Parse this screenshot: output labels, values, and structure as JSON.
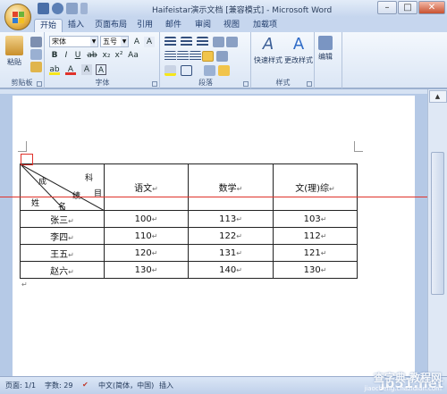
{
  "window": {
    "title": "Haifeistar演示文档 [兼容模式] - Microsoft Word"
  },
  "tabs": [
    "开始",
    "插入",
    "页面布局",
    "引用",
    "邮件",
    "审阅",
    "视图",
    "加载项"
  ],
  "ribbon": {
    "clipboard": {
      "label": "剪贴板",
      "paste": "粘贴"
    },
    "font": {
      "label": "字体",
      "font_name": "宋体",
      "font_size": "五号"
    },
    "paragraph": {
      "label": "段落"
    },
    "styles": {
      "label": "样式",
      "quick_styles": "快速样式",
      "change_styles": "更改样式"
    },
    "editing": {
      "label": "编辑",
      "edit": "编辑"
    }
  },
  "table": {
    "diag": {
      "top_right": "科",
      "top_right2": "目",
      "left_top": "成",
      "mid": "绩",
      "bottom_left": "姓",
      "bottom_mid": "名"
    },
    "headers": [
      "语文",
      "数学",
      "文(理)综"
    ],
    "rows": [
      {
        "name": "张三",
        "v1": "100",
        "v2": "113",
        "v3": "103"
      },
      {
        "name": "李四",
        "v1": "110",
        "v2": "122",
        "v3": "112"
      },
      {
        "name": "王五",
        "v1": "120",
        "v2": "131",
        "v3": "121"
      },
      {
        "name": "赵六",
        "v1": "130",
        "v2": "140",
        "v3": "130"
      }
    ]
  },
  "status": {
    "page": "页面: 1/1",
    "words": "字数: 29",
    "lang": "中文(简体，中国)",
    "mode": "插入"
  },
  "watermark": {
    "site": "jb51.net",
    "brand": "查字典 教程网",
    "url": "jiaocheng.chazidian.com"
  },
  "colors": {
    "accent_red": "#e0312a",
    "ribbon_blue": "#c6d6ee"
  }
}
